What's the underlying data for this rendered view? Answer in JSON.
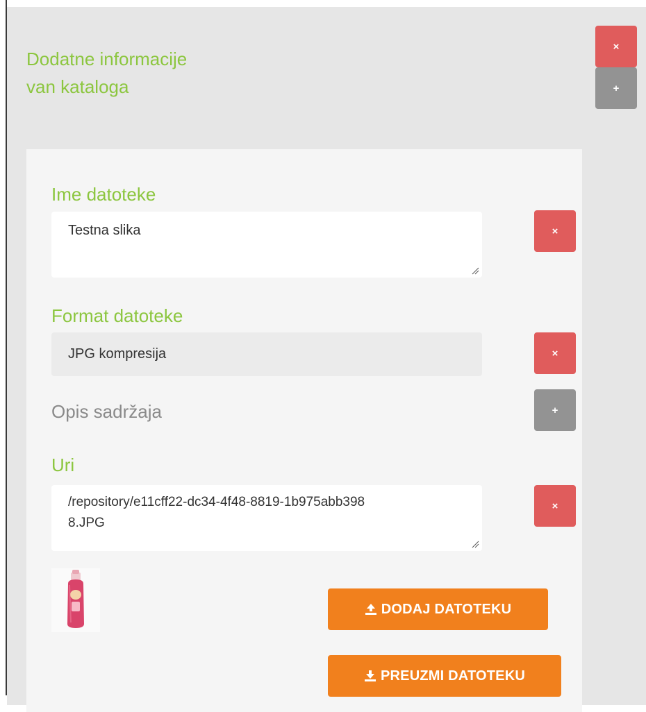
{
  "panel": {
    "title": "Dodatne informacije van kataloga",
    "remove_label": "×",
    "add_label": "+"
  },
  "fields": {
    "ime_datoteke": {
      "label": "Ime datoteke",
      "value": "Testna slika",
      "remove_label": "×"
    },
    "format_datoteke": {
      "label": "Format datoteke",
      "value": "JPG kompresija",
      "remove_label": "×"
    },
    "opis_sadrzaja": {
      "label": "Opis sadržaja",
      "add_label": "+"
    },
    "uri": {
      "label": "Uri",
      "value": "/repository/e11cff22-dc34-4f48-8819-1b975abb3988.JPG",
      "remove_label": "×"
    }
  },
  "actions": {
    "upload_label": "DODAJ DATOTEKU",
    "download_label": "PREUZMI DATOTEKU"
  },
  "icons": {
    "upload": "upload-icon",
    "download": "download-icon",
    "thumbnail": "bottle-thumbnail"
  },
  "colors": {
    "label_green": "#8cc63f",
    "danger": "#e05c5c",
    "neutral": "#939393",
    "action_orange": "#f1801d"
  }
}
